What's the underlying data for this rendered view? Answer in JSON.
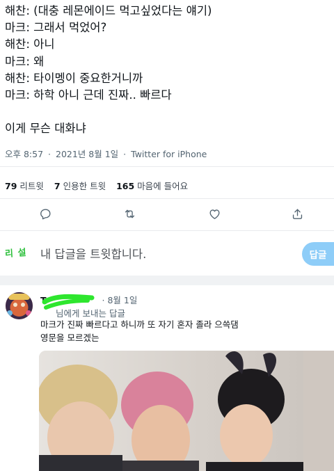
{
  "tweet": {
    "lines": [
      "해찬: (대충 레몬에이드 먹고싶었다는 얘기)",
      "마크: 그래서 먹었어?",
      "해찬: 아니",
      "마크: 왜",
      "해찬: 타이멩이 중요한거니까",
      "마크: 하학 아니 근데 진짜.. 빠르다"
    ],
    "closing": "이게 무슨 대화냐",
    "time": "오후 8:57",
    "separator": "·",
    "date": "2021년 8월 1일",
    "source": "Twitter for iPhone"
  },
  "stats": [
    {
      "count": "79",
      "label": "리트윗"
    },
    {
      "count": "7",
      "label": "인용한 트윗"
    },
    {
      "count": "165",
      "label": "마음에 들어요"
    }
  ],
  "actions": {
    "reply_icon": "reply-icon",
    "retweet_icon": "retweet-icon",
    "like_icon": "heart-icon",
    "share_icon": "share-icon"
  },
  "composer": {
    "avatar_text": "리 설",
    "placeholder": "내 답글을 트윗합니다.",
    "button_label": "답글"
  },
  "reply": {
    "name": "T",
    "date": "· 8월 1일",
    "reply_to": "님에게 보내는 답글",
    "text_lines": [
      "마크가 진짜 빠르다고 하니까 또 자기 혼자 졸라 으쓱댐",
      "영문을 모르겠는"
    ]
  },
  "colors": {
    "accent_disabled": "#8ecdf8",
    "secondary_text": "#536471",
    "scribble_green": "#2ee62e"
  }
}
